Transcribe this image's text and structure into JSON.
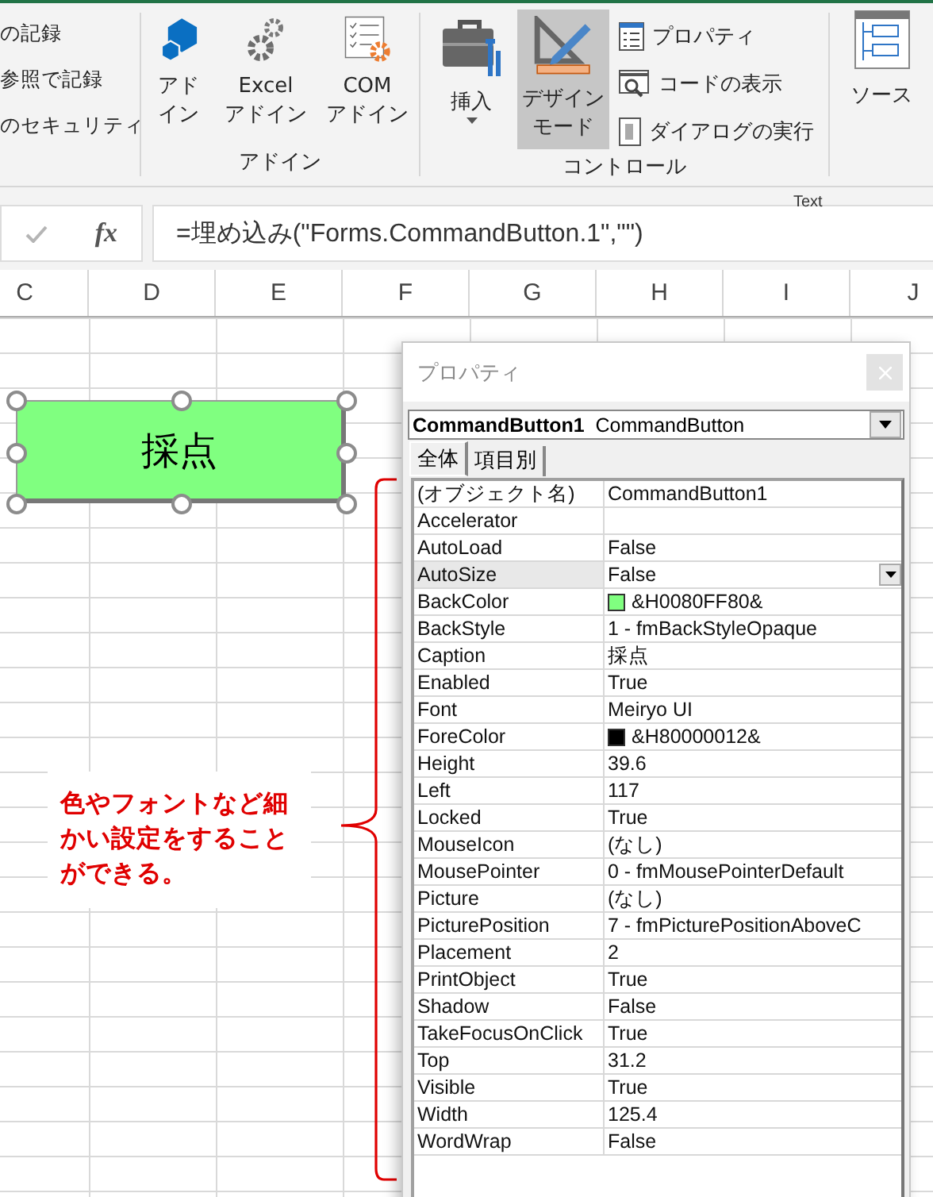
{
  "ribbon": {
    "left_commands": [
      "の記録",
      "参照で記録",
      "のセキュリティ"
    ],
    "addin_group": {
      "label": "アドイン",
      "buttons": [
        {
          "lines": [
            "アド",
            "イン"
          ]
        },
        {
          "lines": [
            "Excel",
            "アドイン"
          ]
        },
        {
          "lines": [
            "COM",
            "アドイン"
          ]
        }
      ]
    },
    "control_group": {
      "label": "コントロール",
      "large_buttons": [
        {
          "lines": [
            "挿入"
          ],
          "dropdown": true,
          "selected": false
        },
        {
          "lines": [
            "デザイン",
            "モード"
          ],
          "dropdown": false,
          "selected": true
        }
      ],
      "small_buttons": [
        "プロパティ",
        "コードの表示",
        "ダイアログの実行"
      ]
    },
    "source_button": "ソース"
  },
  "floating_label": "Text",
  "formula_bar": {
    "function_button": "fx",
    "formula": "=埋め込み(\"Forms.CommandButton.1\",\"\")"
  },
  "columns": [
    "C",
    "D",
    "E",
    "F",
    "G",
    "H",
    "I",
    "J"
  ],
  "sheet_button": {
    "caption": "採点"
  },
  "annotation": "色やフォントなど細かい設定をすることができる。",
  "properties_window": {
    "title": "プロパティ",
    "object_name": "CommandButton1",
    "object_type": "CommandButton",
    "tabs": [
      {
        "label": "全体",
        "selected": true
      },
      {
        "label": "項目別",
        "selected": false
      }
    ],
    "rows": [
      {
        "name": "(オブジェクト名)",
        "value": "CommandButton1",
        "selected": false
      },
      {
        "name": "Accelerator",
        "selected": false
      },
      {
        "name": "AutoLoad",
        "value": "False",
        "selected": false
      },
      {
        "name": "AutoSize",
        "value": "False",
        "selected": true
      },
      {
        "name": "BackColor",
        "value": "&H0080FF80&",
        "color": "#80ff80",
        "selected": false
      },
      {
        "name": "BackStyle",
        "value": "1 - fmBackStyleOpaque",
        "selected": false
      },
      {
        "name": "Caption",
        "value": "採点",
        "selected": false
      },
      {
        "name": "Enabled",
        "value": "True",
        "selected": false
      },
      {
        "name": "Font",
        "value": "Meiryo UI",
        "selected": false
      },
      {
        "name": "ForeColor",
        "value": "&H80000012&",
        "color": "#000000",
        "selected": false
      },
      {
        "name": "Height",
        "value": "39.6",
        "selected": false
      },
      {
        "name": "Left",
        "value": "117",
        "selected": false
      },
      {
        "name": "Locked",
        "value": "True",
        "selected": false
      },
      {
        "name": "MouseIcon",
        "value": "(なし)",
        "selected": false
      },
      {
        "name": "MousePointer",
        "value": "0 - fmMousePointerDefault",
        "selected": false
      },
      {
        "name": "Picture",
        "value": "(なし)",
        "selected": false
      },
      {
        "name": "PicturePosition",
        "value": "7 - fmPicturePositionAboveC",
        "selected": false
      },
      {
        "name": "Placement",
        "value": "2",
        "selected": false
      },
      {
        "name": "PrintObject",
        "value": "True",
        "selected": false
      },
      {
        "name": "Shadow",
        "value": "False",
        "selected": false
      },
      {
        "name": "TakeFocusOnClick",
        "value": "True",
        "selected": false
      },
      {
        "name": "Top",
        "value": "31.2",
        "selected": false
      },
      {
        "name": "Visible",
        "value": "True",
        "selected": false
      },
      {
        "name": "Width",
        "value": "125.4",
        "selected": false
      },
      {
        "name": "WordWrap",
        "value": "False",
        "selected": false
      }
    ]
  }
}
